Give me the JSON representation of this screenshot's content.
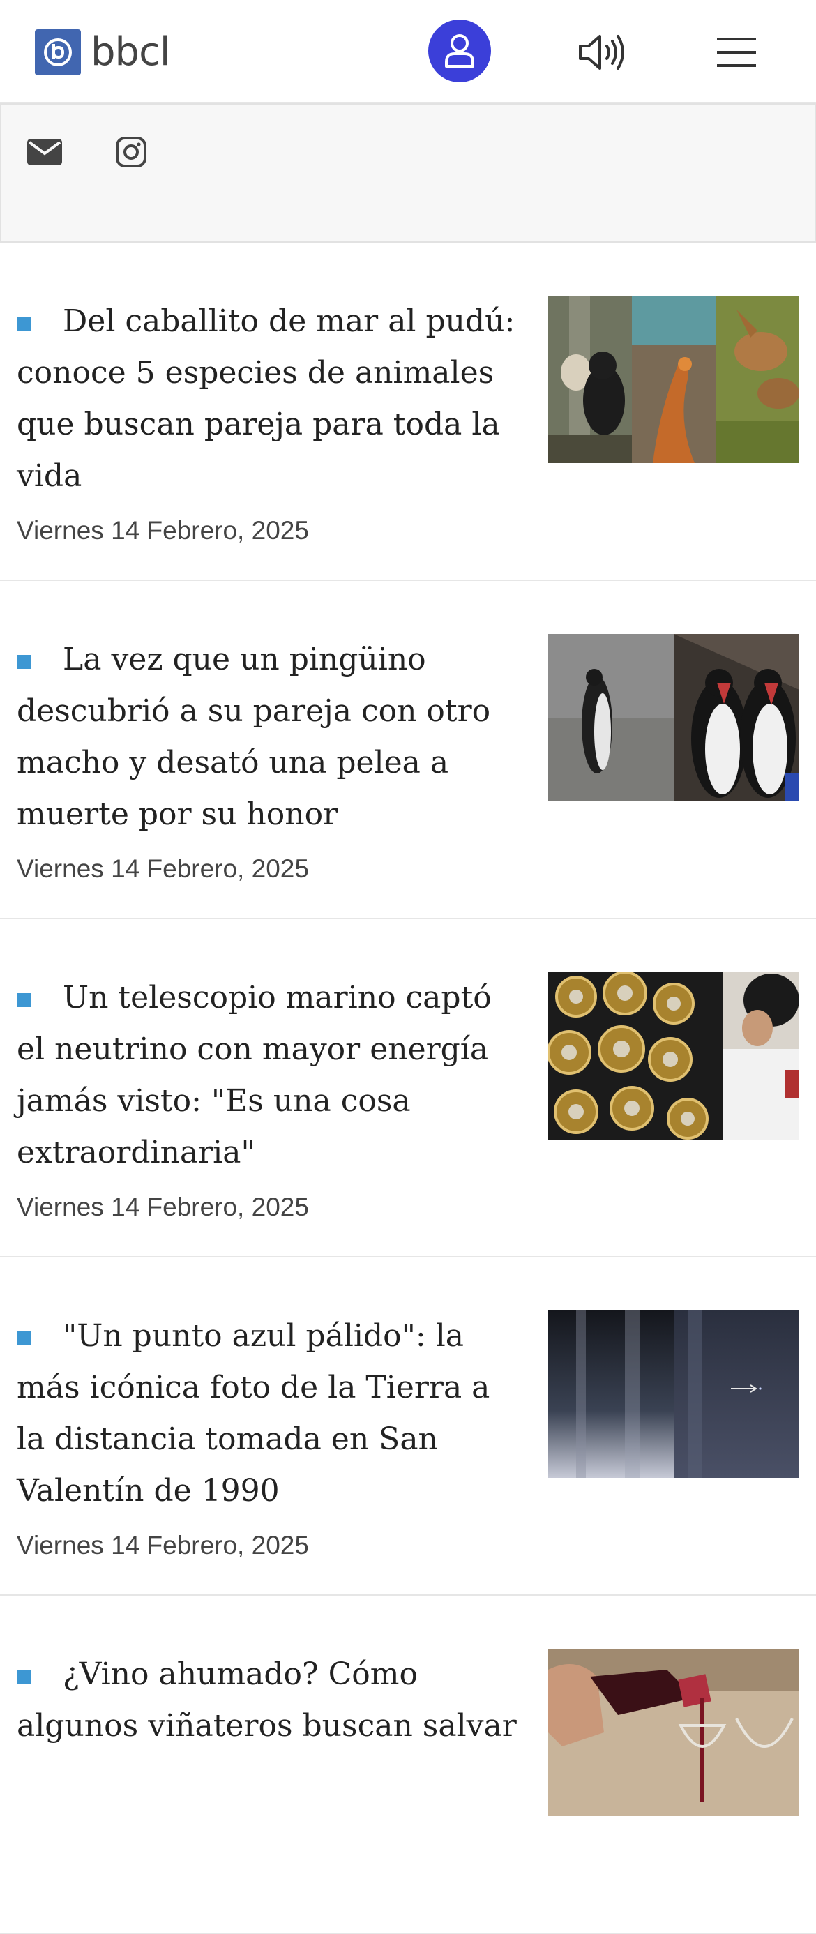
{
  "header": {
    "logo_text": "bbcl",
    "icons": [
      "logo-mark-icon",
      "user-icon",
      "speaker-icon",
      "hamburger-menu-icon"
    ],
    "user_button_color": "#3b3fd9",
    "logo_color": "#4166b0"
  },
  "social": {
    "icons": [
      "mail-icon",
      "instagram-icon"
    ]
  },
  "bullet_color": "#3d97d3",
  "articles": [
    {
      "title": "Del caballito de mar al pudú: conoce 5 especies de animales que buscan pareja para toda la vida",
      "date": "Viernes 14 Febrero, 2025",
      "thumbnail": "animals-collage"
    },
    {
      "title": "La vez que un pingüino descubrió a su pareja con otro macho y desató una pelea a muerte por su honor",
      "date": "Viernes 14 Febrero, 2025",
      "thumbnail": "penguins"
    },
    {
      "title": "Un telescopio marino captó el neutrino con mayor energía jamás visto: \"Es una cosa extraordinaria\"",
      "date": "Viernes 14 Febrero, 2025",
      "thumbnail": "telescope-sensors"
    },
    {
      "title": "\"Un punto azul pálido\": la más icónica foto de la Tierra a la distancia tomada en San Valentín de 1990",
      "date": "Viernes 14 Febrero, 2025",
      "thumbnail": "pale-blue-dot"
    },
    {
      "title": "¿Vino ahumado? Cómo algunos viñateros buscan salvar",
      "date": "",
      "thumbnail": "wine-pouring"
    }
  ]
}
